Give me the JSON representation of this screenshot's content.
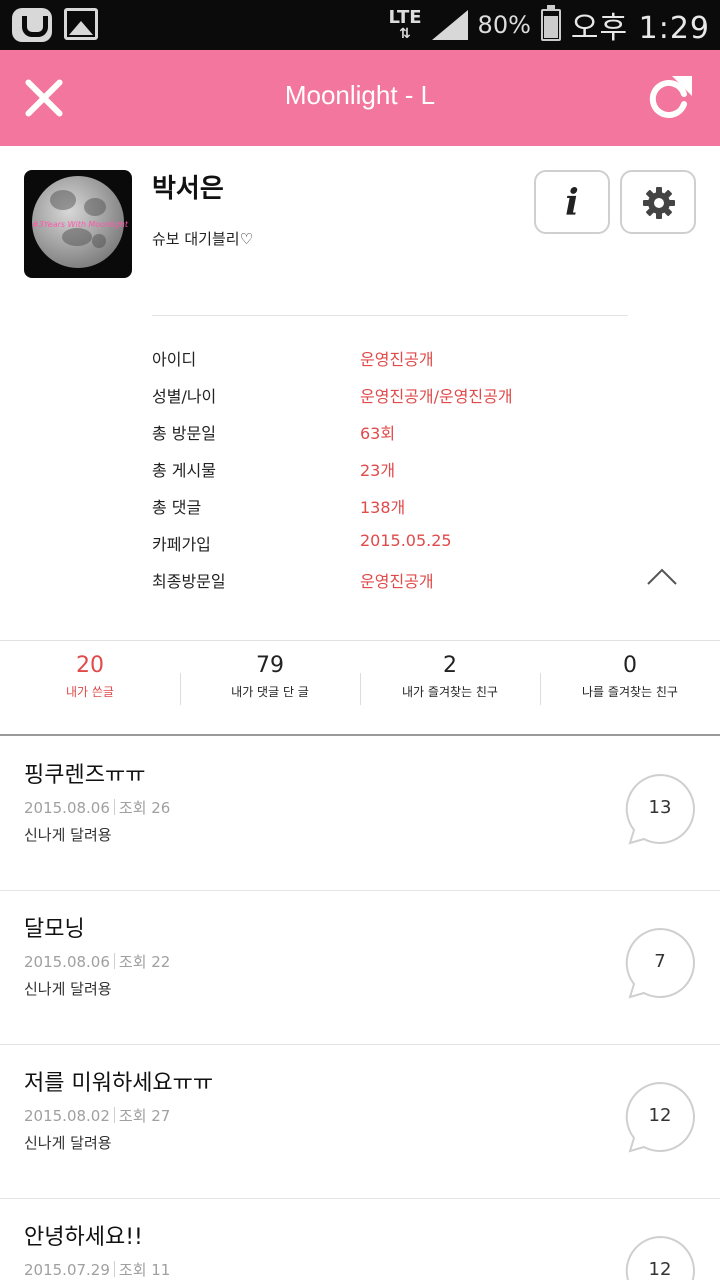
{
  "status_bar": {
    "network": "LTE",
    "battery": "80%",
    "time": "오후 1:29"
  },
  "header": {
    "title": "Moonlight - L"
  },
  "profile": {
    "name": "박서은",
    "status_message": "슈보 대기블리♡",
    "avatar_text": "#3Years With Moonlight",
    "info": [
      {
        "label": "아이디",
        "value": "운영진공개"
      },
      {
        "label": "성별/나이",
        "value": "운영진공개/운영진공개"
      },
      {
        "label": "총 방문일",
        "value": "63회"
      },
      {
        "label": "총 게시물",
        "value": "23개"
      },
      {
        "label": "총 댓글",
        "value": "138개"
      },
      {
        "label": "카페가입",
        "value": "2015.05.25"
      },
      {
        "label": "최종방문일",
        "value": "운영진공개"
      }
    ]
  },
  "stats": [
    {
      "count": "20",
      "label": "내가 쓴글"
    },
    {
      "count": "79",
      "label": "내가 댓글 단 글"
    },
    {
      "count": "2",
      "label": "내가 즐겨찾는 친구"
    },
    {
      "count": "0",
      "label": "나를 즐겨찾는 친구"
    }
  ],
  "posts": [
    {
      "title": "핑쿠렌즈ㅠㅠ",
      "date": "2015.08.06",
      "views": "조회 26",
      "board": "신나게 달려용",
      "comments": "13"
    },
    {
      "title": "달모닝",
      "date": "2015.08.06",
      "views": "조회 22",
      "board": "신나게 달려용",
      "comments": "7"
    },
    {
      "title": "저를 미워하세요ㅠㅠ",
      "date": "2015.08.02",
      "views": "조회 27",
      "board": "신나게 달려용",
      "comments": "12"
    },
    {
      "title": "안녕하세요!!",
      "date": "2015.07.29",
      "views": "조회 11",
      "board": "",
      "comments": "12"
    }
  ],
  "colors": {
    "header_bg": "#f2769d",
    "accent_red": "#e04a4a"
  },
  "icons": {
    "close": "close-icon",
    "refresh": "refresh-icon",
    "info": "info-icon",
    "settings": "gear-icon",
    "collapse": "chevron-up-icon",
    "comment": "speech-bubble-icon"
  }
}
